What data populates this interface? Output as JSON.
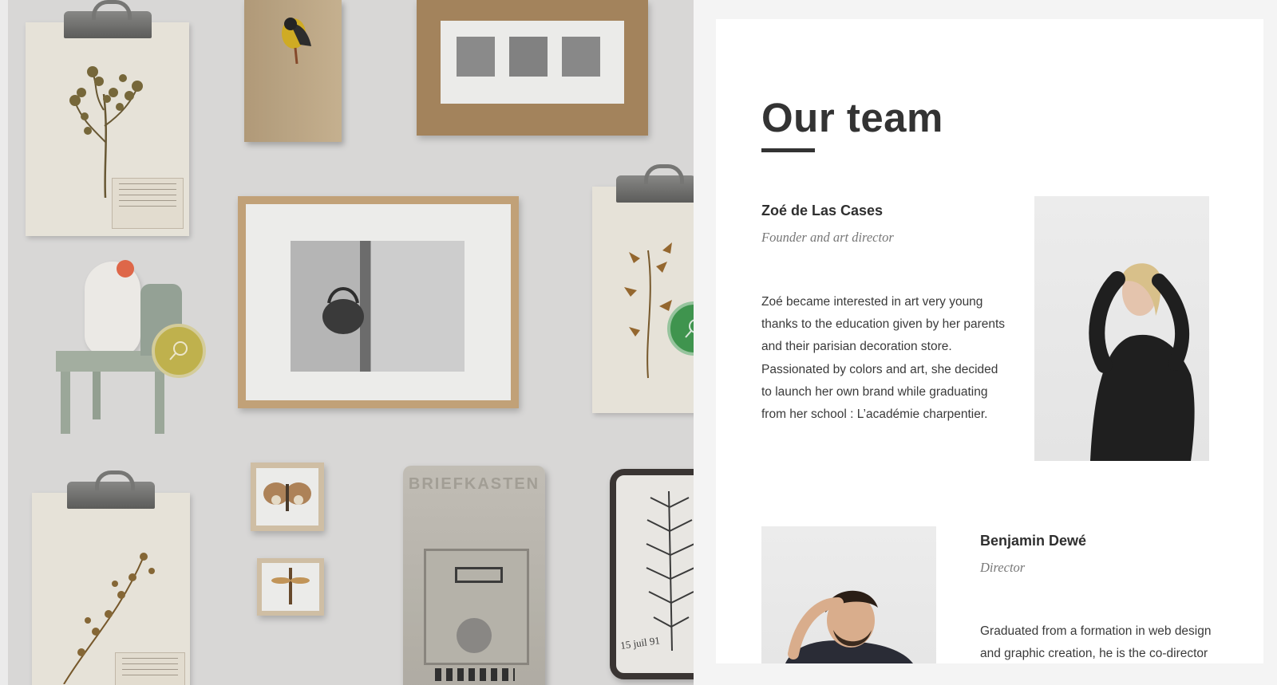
{
  "team": {
    "title": "Our team",
    "members": [
      {
        "name": "Zoé de Las Cases",
        "role": "Founder and art director",
        "bio_lines": [
          "Zoé became interested in art very young",
          "thanks to the education given by her parents",
          "and their parisian decoration store.",
          "Passionated by colors and art, she decided",
          "to launch her own brand while graduating",
          "from her school : L’académie charpentier."
        ]
      },
      {
        "name": "Benjamin Dewé",
        "role": "Director",
        "bio_lines": [
          "Graduated from a formation in web design",
          "and graphic creation, he is the co-director"
        ]
      }
    ]
  },
  "wall": {
    "zoom_buttons": [
      {
        "icon": "search-icon",
        "color": "#c7b84e"
      },
      {
        "icon": "search-icon",
        "color": "#3f9a4f"
      }
    ],
    "mailbox_lettering": "BRIEFKASTEN",
    "herbarium_caption": "15 juil 91"
  },
  "colors": {
    "panel_bg": "#ffffff",
    "page_bg": "#f4f4f4",
    "heading": "#333333",
    "role_text": "#777777"
  }
}
